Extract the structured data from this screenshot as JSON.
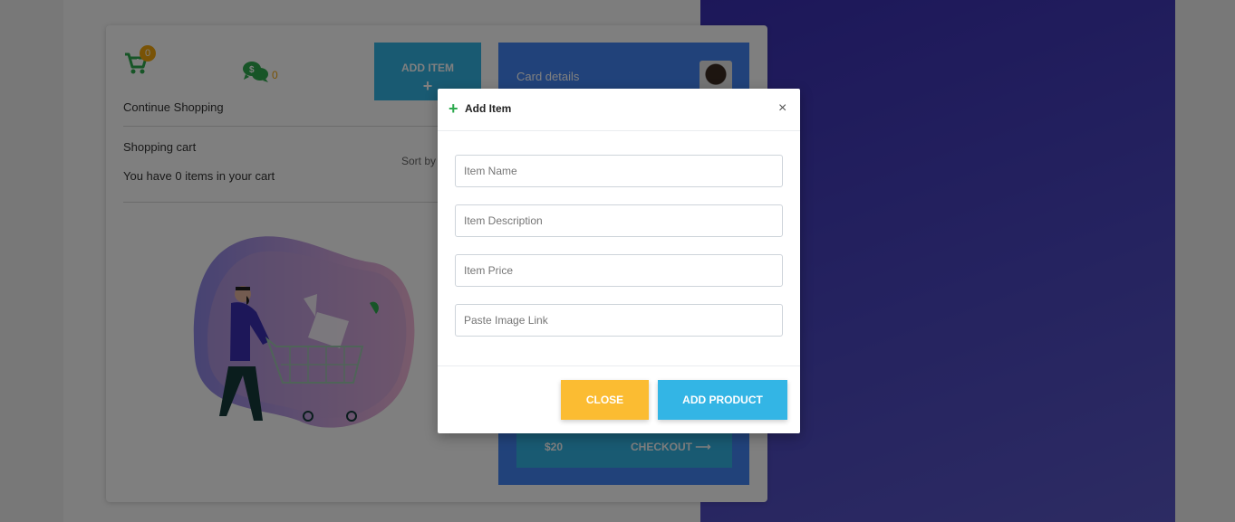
{
  "cart": {
    "badge_count": "0",
    "money_count": "0"
  },
  "toolbar": {
    "add_item_label": "ADD ITEM",
    "add_item_plus": "+"
  },
  "card_details": {
    "title": "Card details"
  },
  "checkout": {
    "price": "$20",
    "label": "CHECKOUT ⟶"
  },
  "main": {
    "continue_label": "Continue Shopping",
    "shopping_cart": "Shopping cart",
    "items_count": "You have 0 items in your cart",
    "sort_by": "Sort by"
  },
  "modal": {
    "title": "Add Item",
    "plus": "+",
    "close_icon": "×",
    "fields": {
      "name_placeholder": "Item Name",
      "description_placeholder": "Item Description",
      "price_placeholder": "Item Price",
      "image_placeholder": "Paste Image Link"
    },
    "close_button": "CLOSE",
    "add_button": "ADD PRODUCT"
  },
  "colors": {
    "accent_blue": "#33b5e5",
    "card_blue": "#4285f4",
    "warning_yellow": "#fbbc32",
    "badge_orange": "#f2a60d",
    "icon_green": "#2eaa4f",
    "purple_bg": "#3a2fb3"
  },
  "icons": [
    "cart-icon",
    "money-chat-icon",
    "plus-icon",
    "close-icon",
    "arrow-right-icon"
  ]
}
